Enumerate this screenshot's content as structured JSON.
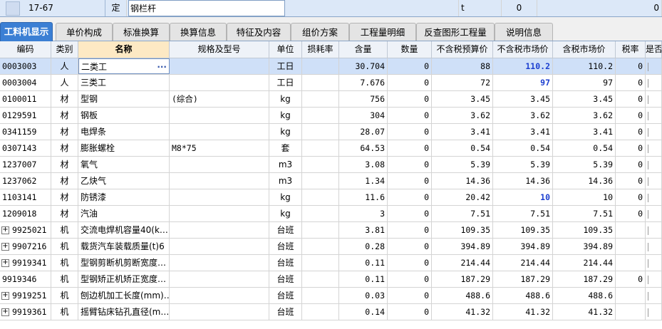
{
  "top_row": {
    "code": "17-67",
    "type": "定",
    "name": "钢栏杆",
    "unit": "t",
    "quantity": "0",
    "price": "0"
  },
  "tabs": [
    {
      "label": "工料机显示",
      "active": true
    },
    {
      "label": "单价构成"
    },
    {
      "label": "标准换算"
    },
    {
      "label": "换算信息"
    },
    {
      "label": "特征及内容"
    },
    {
      "label": "组价方案"
    },
    {
      "label": "工程量明细"
    },
    {
      "label": "反查图形工程量"
    },
    {
      "label": "说明信息"
    }
  ],
  "headers": [
    "编码",
    "类别",
    "名称",
    "规格及型号",
    "单位",
    "损耗率",
    "含量",
    "数量",
    "不含税预算价",
    "不含税市场价",
    "含税市场价",
    "税率",
    "是否"
  ],
  "rows": [
    {
      "code": "0003003",
      "type": "人",
      "name": "二类工",
      "spec": "",
      "unit": "工日",
      "loss": "",
      "content": "30.704",
      "qty": "0",
      "budget": "88",
      "market": "110.2",
      "market_hl": true,
      "tax_market": "110.2",
      "tax": "0",
      "selected": true
    },
    {
      "code": "0003004",
      "type": "人",
      "name": "三类工",
      "spec": "",
      "unit": "工日",
      "loss": "",
      "content": "7.676",
      "qty": "0",
      "budget": "72",
      "market": "97",
      "market_hl": true,
      "tax_market": "97",
      "tax": "0"
    },
    {
      "code": "0100011",
      "type": "材",
      "name": "型钢",
      "spec": "(综合)",
      "unit": "kg",
      "loss": "",
      "content": "756",
      "qty": "0",
      "budget": "3.45",
      "market": "3.45",
      "tax_market": "3.45",
      "tax": "0"
    },
    {
      "code": "0129591",
      "type": "材",
      "name": "钢板",
      "spec": "",
      "unit": "kg",
      "loss": "",
      "content": "304",
      "qty": "0",
      "budget": "3.62",
      "market": "3.62",
      "tax_market": "3.62",
      "tax": "0"
    },
    {
      "code": "0341159",
      "type": "材",
      "name": "电焊条",
      "spec": "",
      "unit": "kg",
      "loss": "",
      "content": "28.07",
      "qty": "0",
      "budget": "3.41",
      "market": "3.41",
      "tax_market": "3.41",
      "tax": "0"
    },
    {
      "code": "0307143",
      "type": "材",
      "name": "膨胀螺栓",
      "spec": "M8*75",
      "unit": "套",
      "loss": "",
      "content": "64.53",
      "qty": "0",
      "budget": "0.54",
      "market": "0.54",
      "tax_market": "0.54",
      "tax": "0"
    },
    {
      "code": "1237007",
      "type": "材",
      "name": "氧气",
      "spec": "",
      "unit": "m3",
      "loss": "",
      "content": "3.08",
      "qty": "0",
      "budget": "5.39",
      "market": "5.39",
      "tax_market": "5.39",
      "tax": "0"
    },
    {
      "code": "1237062",
      "type": "材",
      "name": "乙炔气",
      "spec": "",
      "unit": "m3",
      "loss": "",
      "content": "1.34",
      "qty": "0",
      "budget": "14.36",
      "market": "14.36",
      "tax_market": "14.36",
      "tax": "0"
    },
    {
      "code": "1103141",
      "type": "材",
      "name": "防锈漆",
      "spec": "",
      "unit": "kg",
      "loss": "",
      "content": "11.6",
      "qty": "0",
      "budget": "20.42",
      "market": "10",
      "market_hl": true,
      "tax_market": "10",
      "tax": "0"
    },
    {
      "code": "1209018",
      "type": "材",
      "name": "汽油",
      "spec": "",
      "unit": "kg",
      "loss": "",
      "content": "3",
      "qty": "0",
      "budget": "7.51",
      "market": "7.51",
      "tax_market": "7.51",
      "tax": "0"
    },
    {
      "code": "9925021",
      "type": "机",
      "name": "交流电焊机容量40(k…",
      "spec": "",
      "unit": "台班",
      "loss": "",
      "content": "3.81",
      "qty": "0",
      "budget": "109.35",
      "market": "109.35",
      "tax_market": "109.35",
      "tax": "",
      "expandable": true
    },
    {
      "code": "9907216",
      "type": "机",
      "name": "载货汽车装载质量(t)6",
      "spec": "",
      "unit": "台班",
      "loss": "",
      "content": "0.28",
      "qty": "0",
      "budget": "394.89",
      "market": "394.89",
      "tax_market": "394.89",
      "tax": "",
      "expandable": true
    },
    {
      "code": "9919341",
      "type": "机",
      "name": "型钢剪断机剪断宽度…",
      "spec": "",
      "unit": "台班",
      "loss": "",
      "content": "0.11",
      "qty": "0",
      "budget": "214.44",
      "market": "214.44",
      "tax_market": "214.44",
      "tax": "",
      "expandable": true
    },
    {
      "code": "9919346",
      "type": "机",
      "name": "型钢矫正机矫正宽度…",
      "spec": "",
      "unit": "台班",
      "loss": "",
      "content": "0.11",
      "qty": "0",
      "budget": "187.29",
      "market": "187.29",
      "tax_market": "187.29",
      "tax": "0"
    },
    {
      "code": "9919251",
      "type": "机",
      "name": "刨边机加工长度(mm)…",
      "spec": "",
      "unit": "台班",
      "loss": "",
      "content": "0.03",
      "qty": "0",
      "budget": "488.6",
      "market": "488.6",
      "tax_market": "488.6",
      "tax": "",
      "expandable": true
    },
    {
      "code": "9919361",
      "type": "机",
      "name": "摇臂钻床钻孔直径(m…",
      "spec": "",
      "unit": "台班",
      "loss": "",
      "content": "0.14",
      "qty": "0",
      "budget": "41.32",
      "market": "41.32",
      "tax_market": "41.32",
      "tax": "",
      "expandable": true
    }
  ],
  "icons": {
    "expand": "plus-box-icon",
    "ellipsis": "ellipsis-icon"
  },
  "colors": {
    "accent": "#3b7fd4",
    "highlight_value": "#1c3fd0",
    "selected_row": "#cfe0f8"
  }
}
